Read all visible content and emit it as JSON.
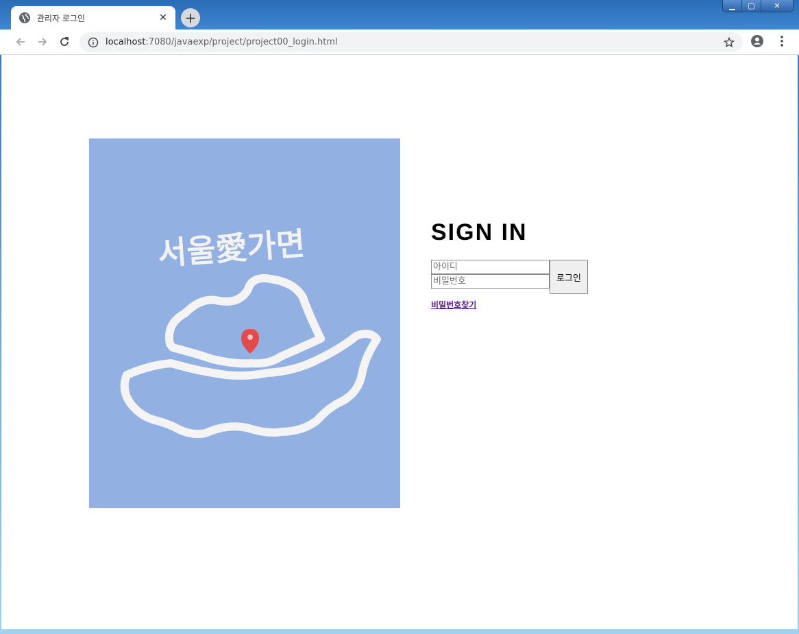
{
  "browser": {
    "tab_title": "관리자 로그인",
    "tab_close": "✕",
    "new_tab": "+",
    "url_host": "localhost",
    "url_path": ":7080/javaexp/project/project00_login.html",
    "window_controls": {
      "minimize": "▁",
      "maximize": "▢",
      "close": "✕"
    }
  },
  "page": {
    "hero_image": {
      "caption_text": "서울愛가면",
      "background_color": "#92b0e1"
    },
    "signin": {
      "title": "SIGN IN",
      "id_placeholder": "아이디",
      "pw_placeholder": "비밀번호",
      "login_button": "로그인",
      "find_password_link": "비밀번호찾기"
    }
  }
}
